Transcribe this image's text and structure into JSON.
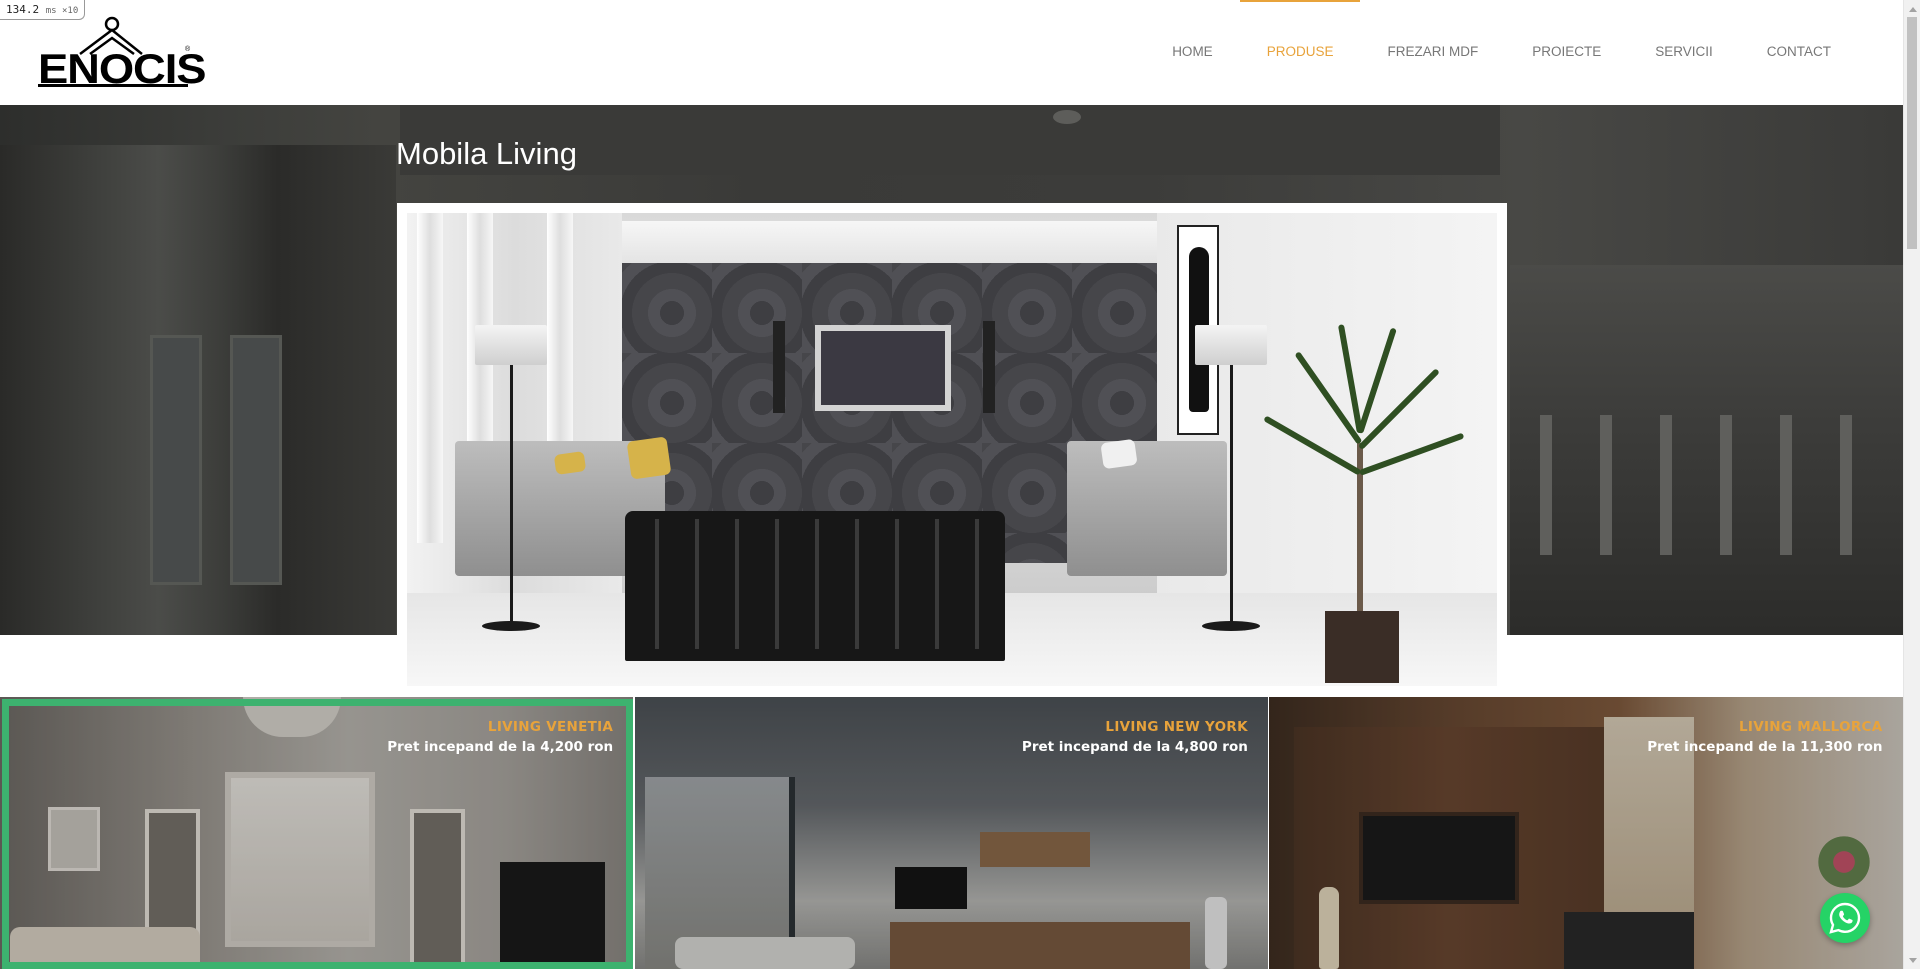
{
  "perf": {
    "value": "134.2",
    "unit": "ms ×10"
  },
  "logo": {
    "text": "ENOCIS",
    "reg": "®"
  },
  "nav": {
    "items": [
      {
        "label": "HOME",
        "active": false
      },
      {
        "label": "PRODUSE",
        "active": true
      },
      {
        "label": "FREZARI MDF",
        "active": false
      },
      {
        "label": "PROIECTE",
        "active": false
      },
      {
        "label": "SERVICII",
        "active": false
      },
      {
        "label": "CONTACT",
        "active": false
      }
    ]
  },
  "page": {
    "title": "Mobila Living"
  },
  "cards": [
    {
      "title": "LIVING VENETIA",
      "price": "Pret incepand de la 4,200 ron",
      "selected": true
    },
    {
      "title": "LIVING NEW YORK",
      "price": "Pret incepand de la 4,800 ron",
      "selected": false
    },
    {
      "title": "LIVING MALLORCA",
      "price": "Pret incepand de la 11,300 ron",
      "selected": false
    }
  ],
  "floating": {
    "icon": "whatsapp-icon"
  },
  "colors": {
    "accent": "#e8a33b",
    "selection": "#3db26f",
    "whatsapp": "#25d366"
  }
}
